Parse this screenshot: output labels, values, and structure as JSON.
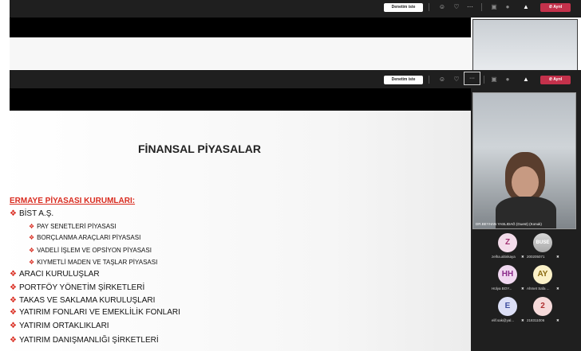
{
  "window1": {
    "denetim_label": "Denetim iste",
    "leave_label": "Ayrıl"
  },
  "window2": {
    "denetim_label": "Denetim iste",
    "leave_label": "Ayrıl",
    "more_label": "···"
  },
  "slide": {
    "title": "FİNANSAL PİYASALAR",
    "heading": "ERMAYE PİYASASI KURUMLARI:",
    "items": [
      {
        "level": 1,
        "text": "BİST A.Ş."
      },
      {
        "level": 2,
        "text": "PAY SENETLERİ PİYASASI"
      },
      {
        "level": 2,
        "text": "BORÇLANMA ARAÇLARI PİYASASI"
      },
      {
        "level": 2,
        "text": "VADELİ İŞLEM VE OPSİYON PİYASASI"
      },
      {
        "level": 2,
        "text": "KIYMETLİ MADEN VE TAŞLAR PİYASASI"
      },
      {
        "level": 1,
        "text": "ARACI KURULUŞLAR"
      },
      {
        "level": 1,
        "text": "PORTFÖY YÖNETİM ŞİRKETLERİ"
      },
      {
        "level": 1,
        "text": "TAKAS VE SAKLAMA KURULUŞLARI"
      },
      {
        "level": 1,
        "text": "YATIRIM FONLARI VE EMEKLİLİK FONLARI"
      },
      {
        "level": 1,
        "text": "YATIRIM ORTAKLIKLARI"
      },
      {
        "level": 1,
        "text": "YATIRIM DANIŞMANLIĞI ŞİRKETLERİ"
      }
    ]
  },
  "presenter": {
    "name": "DR.BEYHAN YASLIDAĞ (Guest) (Konuk)"
  },
  "participants": [
    {
      "initials": "Z",
      "name": "zelha.altinkaya",
      "bg": "#f3dcea",
      "fg": "#a03070"
    },
    {
      "initials": "BUSE",
      "name": "200205071",
      "bg": "#ffffff",
      "fg": "#ffffff",
      "is_photo": true
    },
    {
      "initials": "HH",
      "name": "Hülya BOY...",
      "bg": "#f0d8f0",
      "fg": "#8a2a8a"
    },
    {
      "initials": "AY",
      "name": "Ahmet Safa ...",
      "bg": "#fbf1c8",
      "fg": "#8a6a10"
    },
    {
      "initials": "E",
      "name": "elif.sak@yal...",
      "bg": "#dcdff6",
      "fg": "#4050a0"
    },
    {
      "initials": "2",
      "name": "218311006",
      "bg": "#f6dada",
      "fg": "#b03030"
    }
  ],
  "colors": {
    "accent_red": "#c4314b",
    "bullet_red": "#d92b1f",
    "dark_bar": "#1f1f1f"
  }
}
